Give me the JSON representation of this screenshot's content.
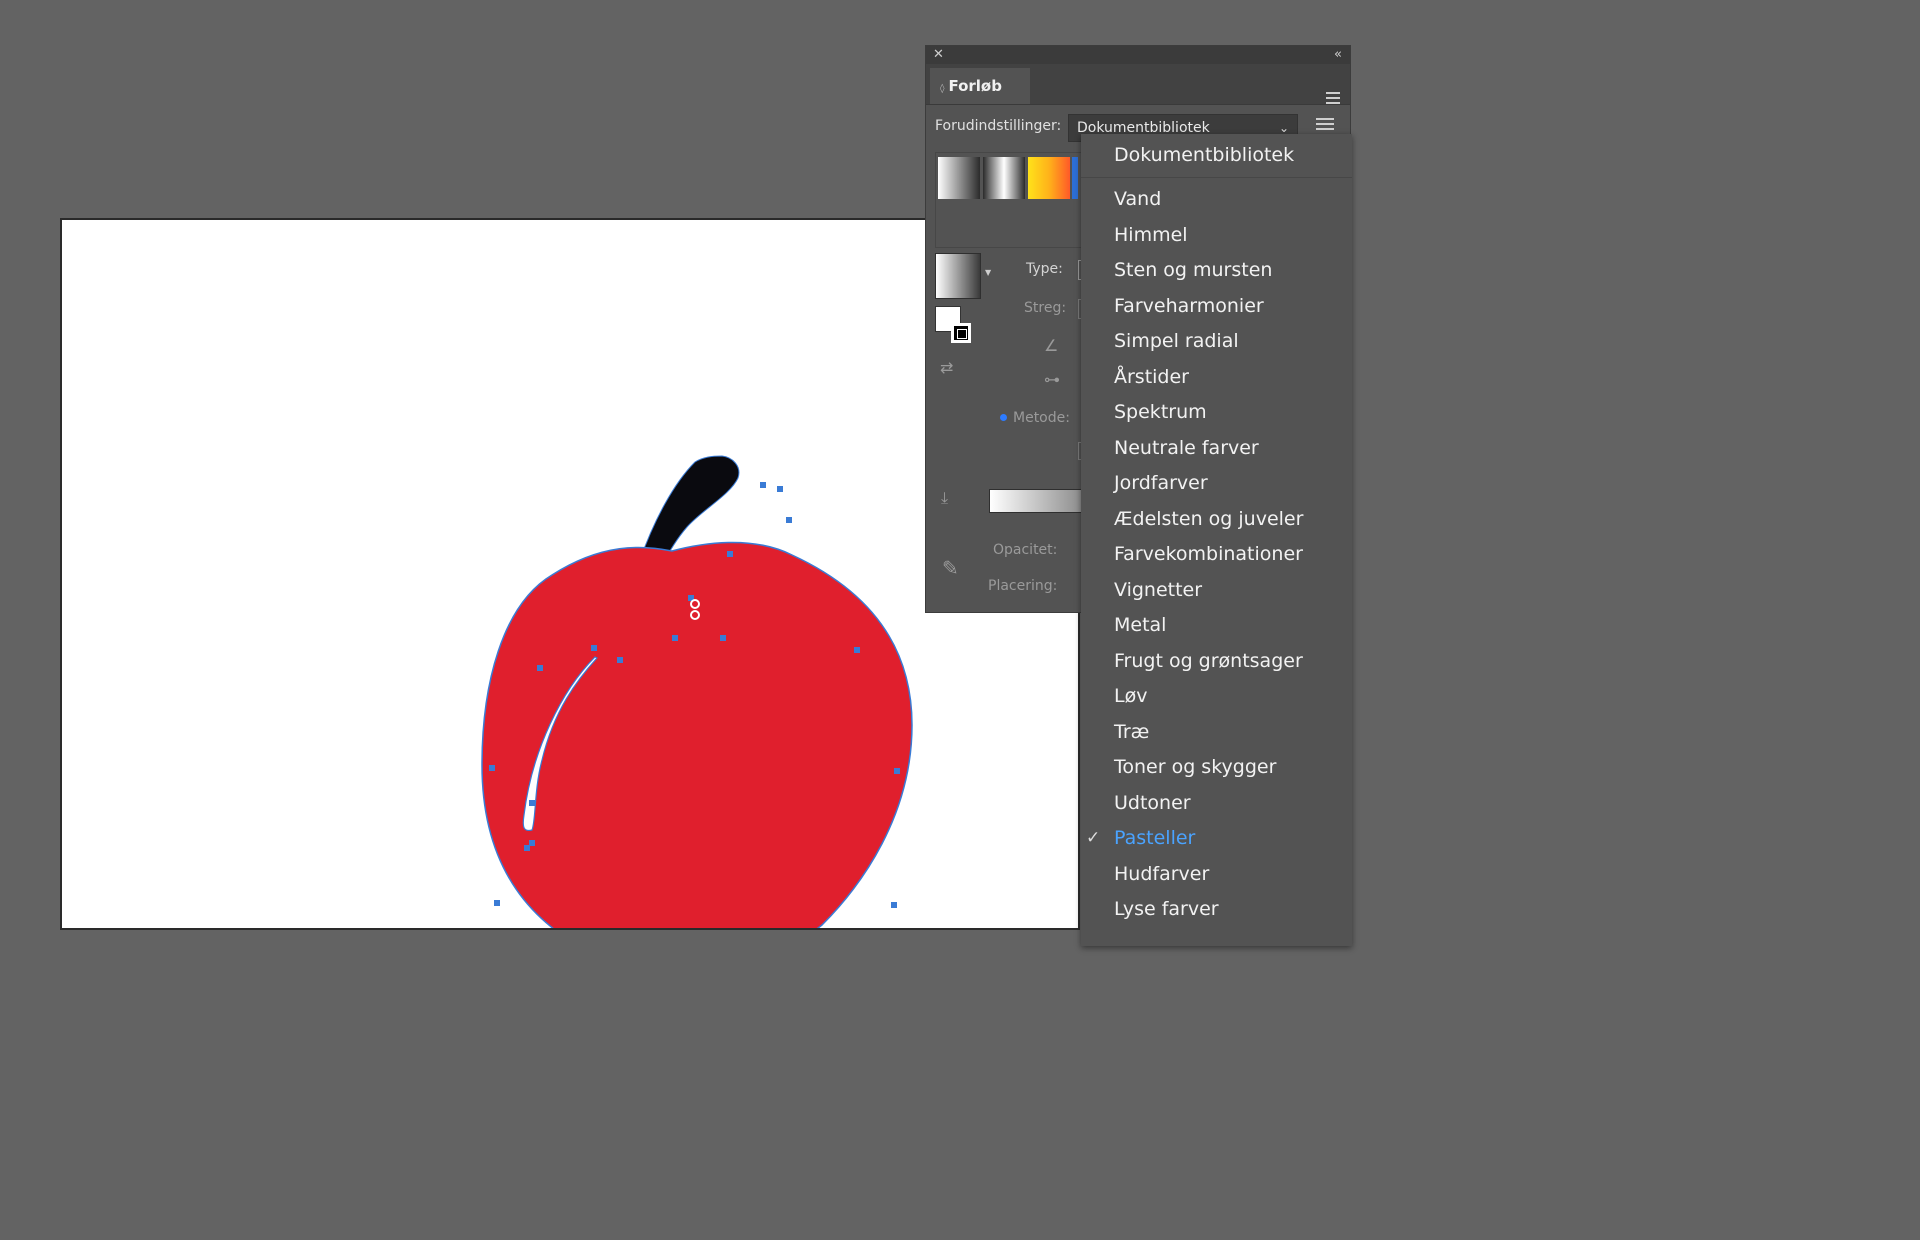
{
  "panel": {
    "tab_label": "Forløb",
    "presets_label": "Forudindstillinger:",
    "presets_value": "Dokumentbibliotek",
    "type_label": "Type:",
    "stroke_label": "Streg:",
    "method_label": "Metode:",
    "opacity_label": "Opacitet:",
    "location_label": "Placering:"
  },
  "dropdown": {
    "header": "Dokumentbibliotek",
    "items": [
      "Vand",
      "Himmel",
      "Sten og mursten",
      "Farveharmonier",
      "Simpel radial",
      "Årstider",
      "Spektrum",
      "Neutrale farver",
      "Jordfarver",
      "Ædelsten og juveler",
      "Farvekombinationer",
      "Vignetter",
      "Metal",
      "Frugt og grøntsager",
      "Løv",
      "Træ",
      "Toner og skygger",
      "Udtoner",
      "Pasteller",
      "Hudfarver",
      "Lyse farver"
    ],
    "selected": "Pasteller"
  },
  "colors": {
    "apple_fill": "#e01f2d",
    "stem_fill": "#0a0a0f",
    "anchor_color": "#3a7bd5",
    "selected_text": "#4aa3ff"
  },
  "icons": [
    "close-icon",
    "collapse-icon",
    "panel-menu-icon",
    "chevron-down-icon",
    "list-view-icon",
    "angle-icon",
    "aspect-ratio-icon",
    "trash-icon",
    "eyedropper-icon",
    "checkmark-icon"
  ]
}
